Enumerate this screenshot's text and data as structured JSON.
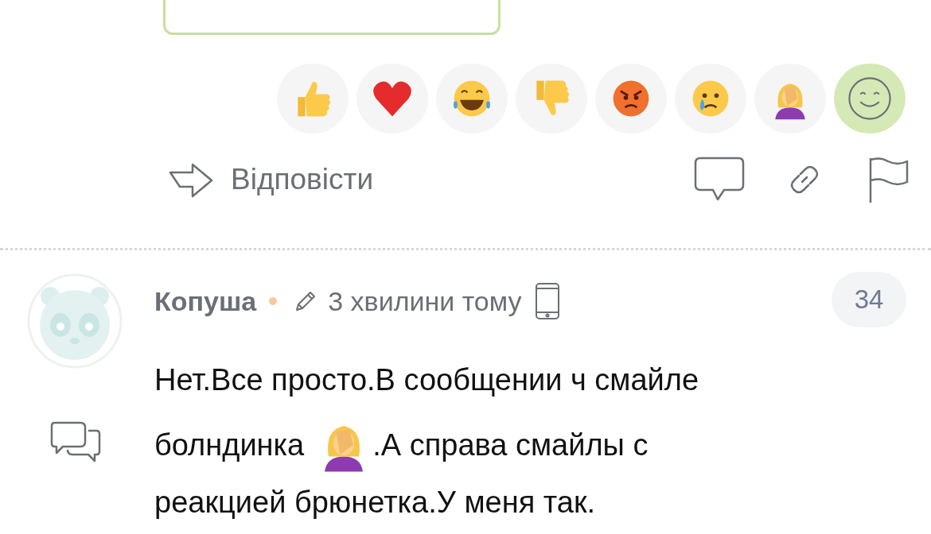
{
  "reactions": [
    {
      "kind": "thumbs_up"
    },
    {
      "kind": "heart"
    },
    {
      "kind": "laugh"
    },
    {
      "kind": "thumbs_down"
    },
    {
      "kind": "angry"
    },
    {
      "kind": "sad"
    },
    {
      "kind": "facepalm"
    },
    {
      "kind": "add"
    }
  ],
  "actions": {
    "reply": "Відповісти"
  },
  "comment": {
    "author": "Копуша",
    "online": true,
    "time": "3 хвилини тому",
    "device": {
      "kind": "phone"
    },
    "score": "34",
    "lines": [
      [
        {
          "kind": "text",
          "text": "Нет.Все просто.В сообщении ч смайле"
        }
      ],
      [
        {
          "kind": "text",
          "text": "болндинка"
        },
        {
          "kind": "facepalm"
        },
        {
          "kind": "text",
          "text": ".А справа смайлы с"
        }
      ],
      [
        {
          "kind": "text",
          "text": "реакцией брюнетка.У меня так."
        }
      ]
    ]
  }
}
